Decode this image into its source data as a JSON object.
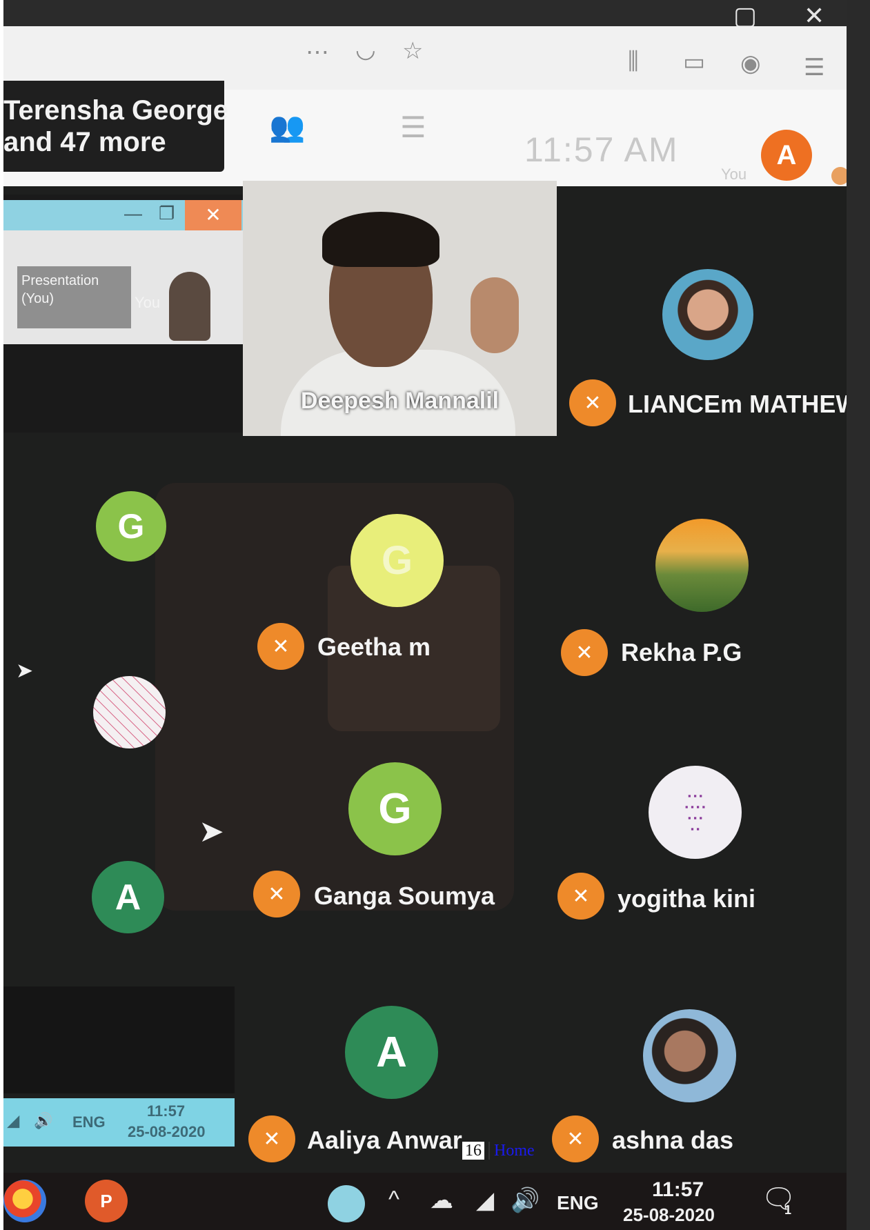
{
  "notification": {
    "line1": "Terensha George",
    "line2": "and 47 more"
  },
  "header": {
    "clock": "11:57 AM",
    "me_initial": "A",
    "you_label": "You"
  },
  "share_thumb": {
    "title": "Presentation",
    "sub": "(You)",
    "you": "You"
  },
  "presenter": {
    "name": "Deepesh Mannalil"
  },
  "participants": [
    {
      "name": "LIANCEm MATHEW",
      "muted": true
    },
    {
      "name": "Geetha m",
      "initial": "G",
      "muted": true
    },
    {
      "name": "Rekha P.G",
      "muted": true
    },
    {
      "name": "Ganga Soumya",
      "initial": "G",
      "muted": true
    },
    {
      "name": "yogitha kini",
      "muted": true
    },
    {
      "name": "Aaliya Anwar",
      "initial": "A",
      "muted": true
    },
    {
      "name": "ashna das",
      "muted": true
    }
  ],
  "left_column": {
    "g_initial": "G",
    "a_initial": "A"
  },
  "mini_taskbar": {
    "lang": "ENG",
    "time": "11:57",
    "date": "25-08-2020"
  },
  "taskbar": {
    "lang": "ENG",
    "time": "11:57",
    "date": "25-08-2020",
    "notif_count": "1"
  },
  "footer": {
    "page": "16",
    "link": "Home"
  },
  "colors": {
    "accent": "#ee7022",
    "mic_muted": "#ee8a2a",
    "green_light": "#8bc34a",
    "green_dark": "#2e8b57"
  }
}
